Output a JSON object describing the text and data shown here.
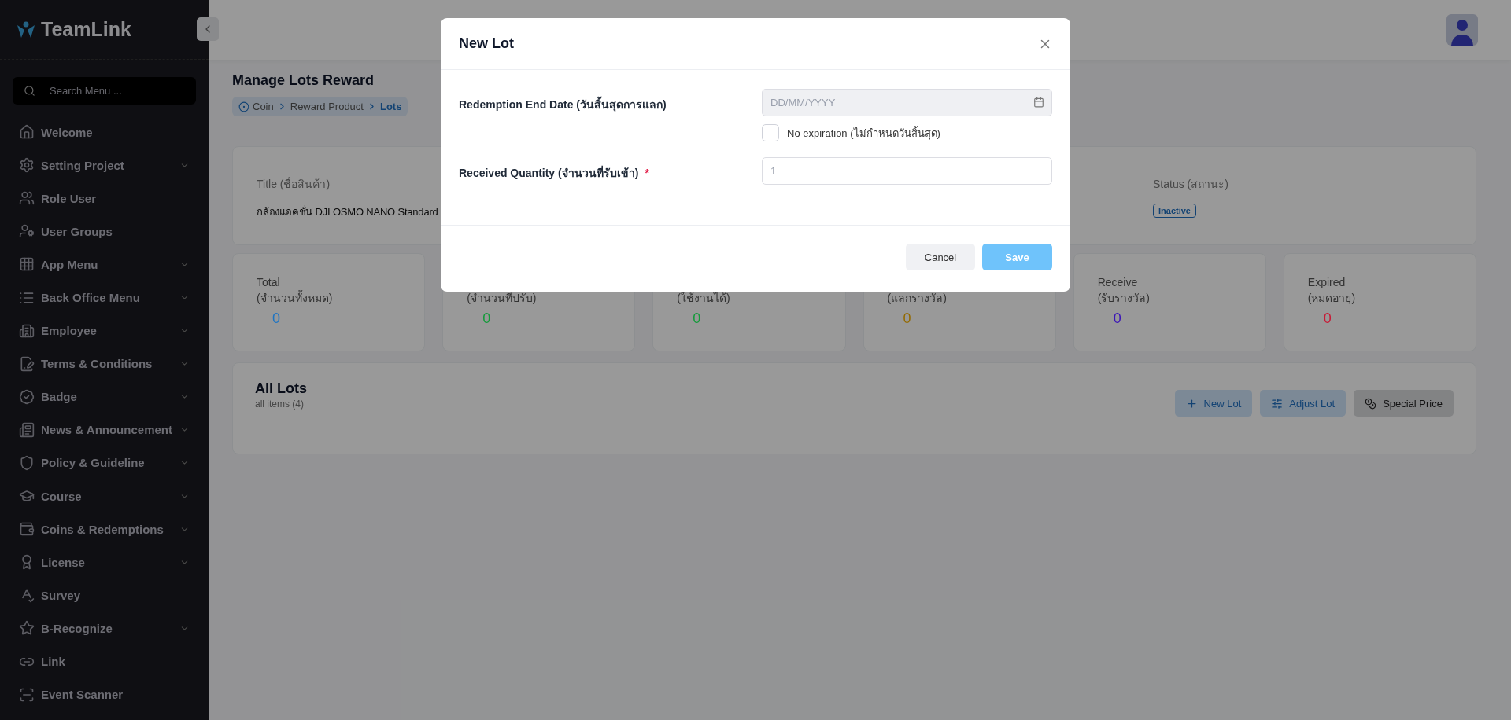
{
  "sidebar": {
    "brand": "TeamLink",
    "search": {
      "placeholder": "Search Menu ..."
    },
    "items": [
      {
        "label": "Welcome",
        "expandable": false
      },
      {
        "label": "Setting Project",
        "expandable": true
      },
      {
        "label": "Role User",
        "expandable": false
      },
      {
        "label": "User Groups",
        "expandable": false
      },
      {
        "label": "App Menu",
        "expandable": true
      },
      {
        "label": "Back Office Menu",
        "expandable": true
      },
      {
        "label": "Employee",
        "expandable": true
      },
      {
        "label": "Terms & Conditions",
        "expandable": true
      },
      {
        "label": "Badge",
        "expandable": true
      },
      {
        "label": "News & Announcement",
        "expandable": true
      },
      {
        "label": "Policy & Guideline",
        "expandable": true
      },
      {
        "label": "Course",
        "expandable": true
      },
      {
        "label": "Coins & Redemptions",
        "expandable": true
      },
      {
        "label": "License",
        "expandable": true
      },
      {
        "label": "Survey",
        "expandable": false
      },
      {
        "label": "B-Recognize",
        "expandable": true
      },
      {
        "label": "Link",
        "expandable": false
      },
      {
        "label": "Event Scanner",
        "expandable": false
      }
    ]
  },
  "page": {
    "title": "Manage Lots Reward",
    "breadcrumb": [
      {
        "label": "Coin",
        "selected": false
      },
      {
        "label": "Reward Product",
        "selected": false
      },
      {
        "label": "Lots",
        "selected": true
      }
    ],
    "details": [
      {
        "label": "Title (ชื่อสินค้า)",
        "value": "กล้องแอคชั่น DJI OSMO NANO Standard",
        "kind": "text"
      },
      {
        "label": "Status (สถานะ)",
        "value": "Inactive",
        "kind": "badge"
      }
    ],
    "stats": [
      {
        "label": "Total",
        "sublabel": "(จำนวนทั้งหมด)",
        "value": "0",
        "color": "#1c74c4"
      },
      {
        "sublabel": "(จำนวนที่ปรับ)",
        "value": "0",
        "color": "#139b3a"
      },
      {
        "sublabel": "(ใช้งานได้)",
        "value": "0",
        "color": "#139b3a"
      },
      {
        "sublabel": "(แลกรางวัล)",
        "value": "0",
        "color": "#946a00"
      },
      {
        "label": "Receive",
        "sublabel": "(รับรางวัล)",
        "value": "0",
        "color": "#3b14b8"
      },
      {
        "label": "Expired",
        "sublabel": "(หมดอายุ)",
        "value": "0",
        "color": "#c81a36"
      }
    ],
    "lots": {
      "title": "All Lots",
      "count": "all items (4)",
      "actions": [
        {
          "label": "New Lot",
          "kind": "add"
        },
        {
          "label": "Adjust Lot",
          "kind": "adjust"
        },
        {
          "label": "Special Price",
          "kind": "price"
        }
      ]
    }
  },
  "modal": {
    "title": "New Lot",
    "fields": [
      {
        "label": "Redemption End Date (วันสิ้นสุดการแลก)",
        "kind": "date",
        "placeholder": "DD/MM/YYYY",
        "disabled": true,
        "required": false,
        "option": {
          "label": "No expiration (ไม่กำหนดวันสิ้นสุด)",
          "checked": false
        }
      },
      {
        "label": "Received Quantity (จำนวนที่รับเข้า)",
        "kind": "number",
        "placeholder": "1",
        "disabled": false,
        "required": true,
        "required_mark": "*"
      }
    ],
    "buttons": [
      {
        "label": "Cancel",
        "kind": "cancel"
      },
      {
        "label": "Save",
        "kind": "save",
        "disabled": true
      }
    ]
  }
}
